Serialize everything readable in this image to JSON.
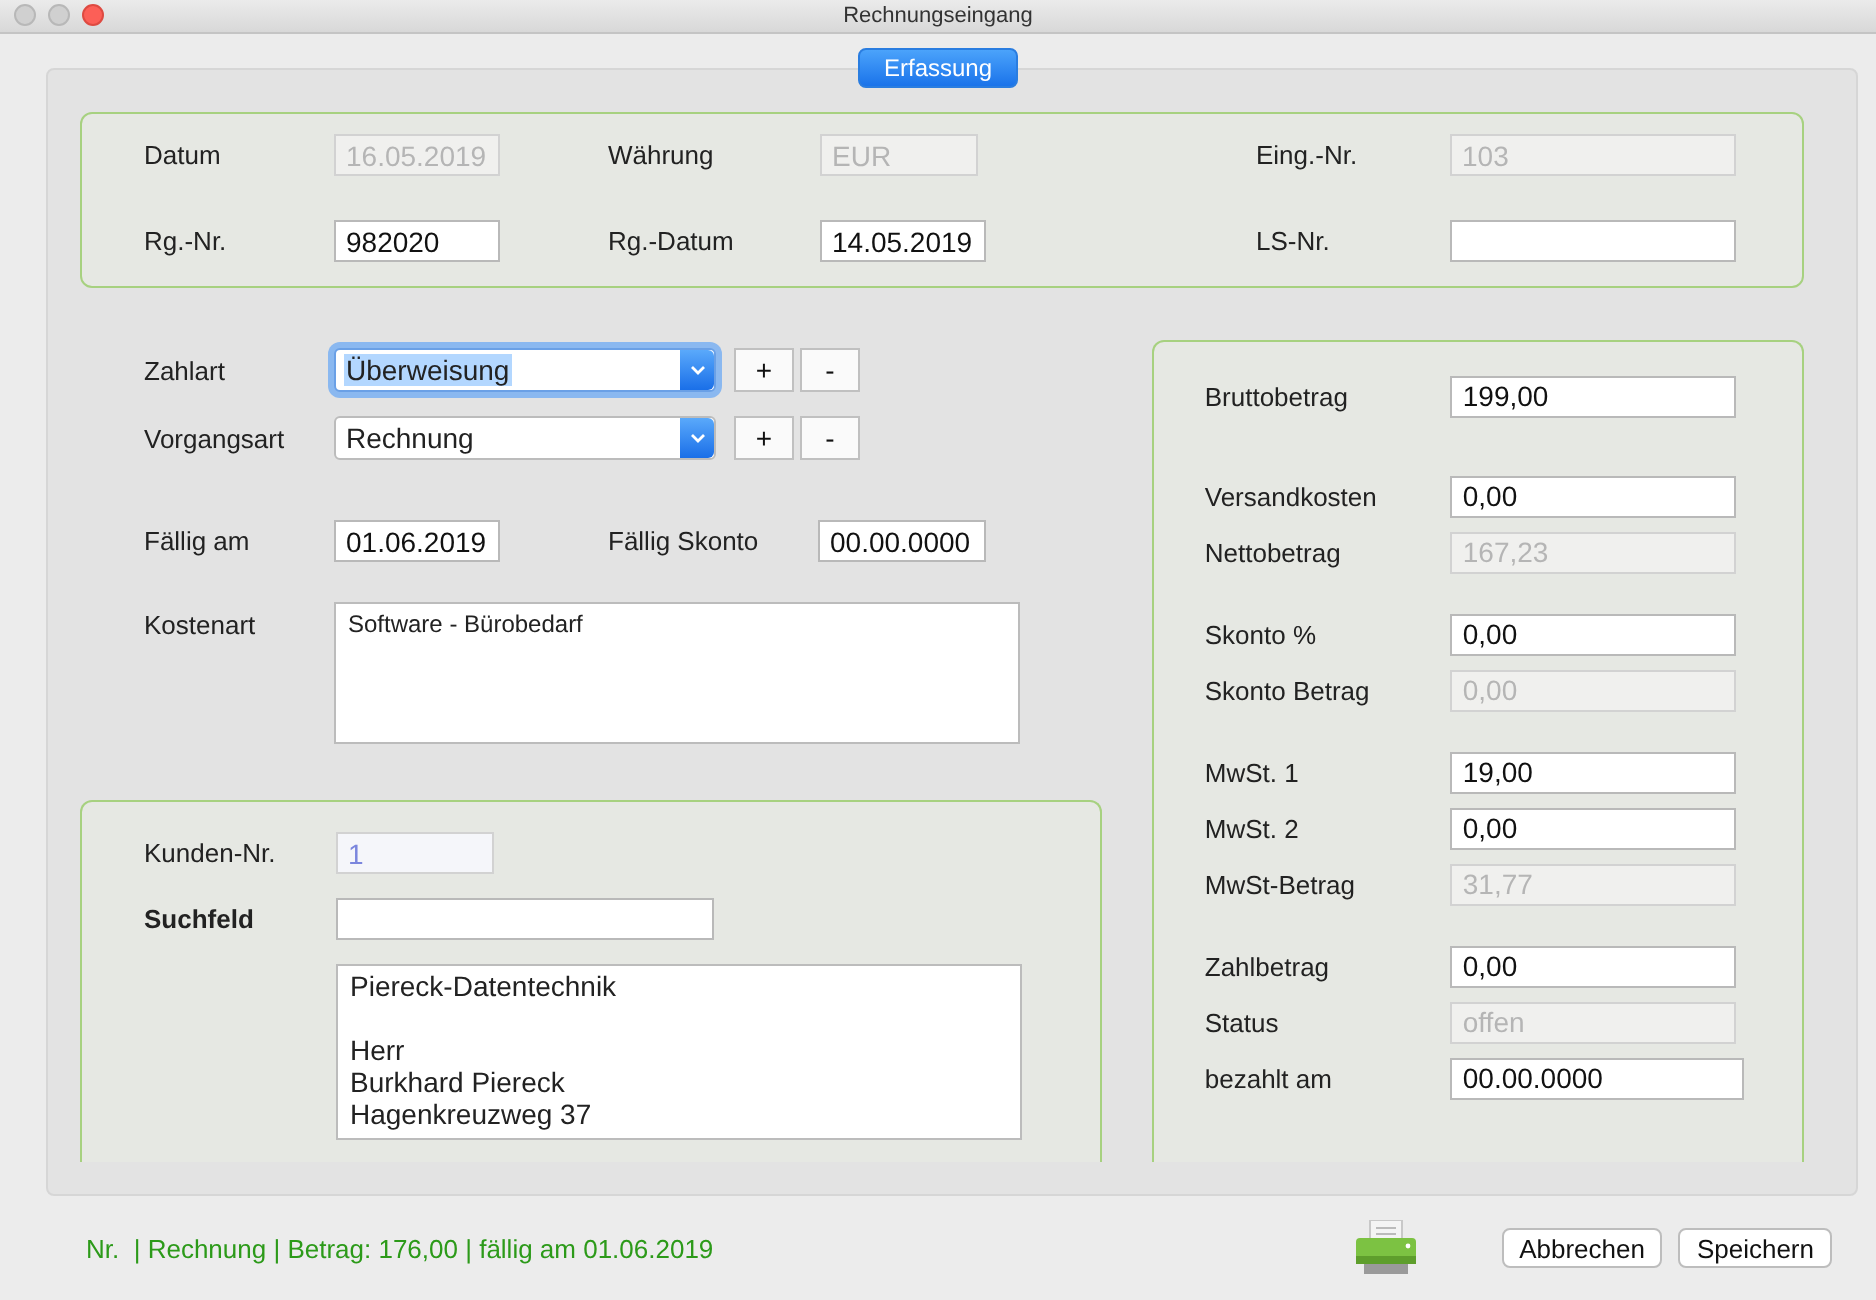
{
  "window": {
    "title": "Rechnungseingang"
  },
  "tabs": [
    {
      "label": "Erfassung",
      "selected": true
    }
  ],
  "header_fields": [
    {
      "label": "Datum",
      "value": "16.05.2019",
      "disabled": true
    },
    {
      "label": "Währung",
      "value": "EUR",
      "disabled": true
    },
    {
      "label": "Eing.-Nr.",
      "value": "103",
      "disabled": true
    },
    {
      "label": "Rg.-Nr.",
      "value": "982020",
      "disabled": false
    },
    {
      "label": "Rg.-Datum",
      "value": "14.05.2019",
      "disabled": false
    },
    {
      "label": "LS-Nr.",
      "disabled": false
    }
  ],
  "payment": {
    "dropdowns": [
      {
        "label": "Zahlart",
        "value": "Überweisung",
        "focused": true,
        "buttons": [
          "+",
          "-"
        ]
      },
      {
        "label": "Vorgangsart",
        "value": "Rechnung",
        "focused": false,
        "buttons": [
          "+",
          "-"
        ]
      }
    ],
    "dates": [
      {
        "label": "Fällig am",
        "value": "01.06.2019"
      },
      {
        "label": "Fällig Skonto",
        "value": "00.00.0000"
      }
    ],
    "cost_type": {
      "label": "Kostenart",
      "value": "Software - Bürobedarf"
    }
  },
  "customer": {
    "fields": [
      {
        "label": "Kunden-Nr.",
        "value": "1",
        "disabled": true,
        "bold": false
      },
      {
        "label": "Suchfeld",
        "disabled": false,
        "bold": true
      }
    ],
    "address": "Piereck-Datentechnik\n\nHerr\nBurkhard Piereck\nHagenkreuzweg 37"
  },
  "amounts": {
    "groups": [
      [
        {
          "label": "Bruttobetrag",
          "value": "199,00",
          "disabled": false
        }
      ],
      [
        {
          "label": "Versandkosten",
          "value": "0,00",
          "disabled": false
        },
        {
          "label": "Nettobetrag",
          "value": "167,23",
          "disabled": true
        }
      ],
      [
        {
          "label": "Skonto %",
          "value": "0,00",
          "disabled": false
        },
        {
          "label": "Skonto Betrag",
          "value": "0,00",
          "disabled": true
        }
      ],
      [
        {
          "label": "MwSt. 1",
          "value": "19,00",
          "disabled": false
        },
        {
          "label": "MwSt. 2",
          "value": "0,00",
          "disabled": false
        },
        {
          "label": "MwSt-Betrag",
          "value": "31,77",
          "disabled": true
        }
      ],
      [
        {
          "label": "Zahlbetrag",
          "value": "0,00",
          "disabled": false
        },
        {
          "label": "Status",
          "value": "offen",
          "disabled": true
        },
        {
          "label": "bezahlt am",
          "value": "00.00.0000",
          "disabled": false
        }
      ]
    ]
  },
  "status_bar": {
    "text": "Nr.  | Rechnung | Betrag: 176,00 | fällig am 01.06.2019"
  },
  "buttons": [
    "Abbrechen",
    "Speichern"
  ]
}
